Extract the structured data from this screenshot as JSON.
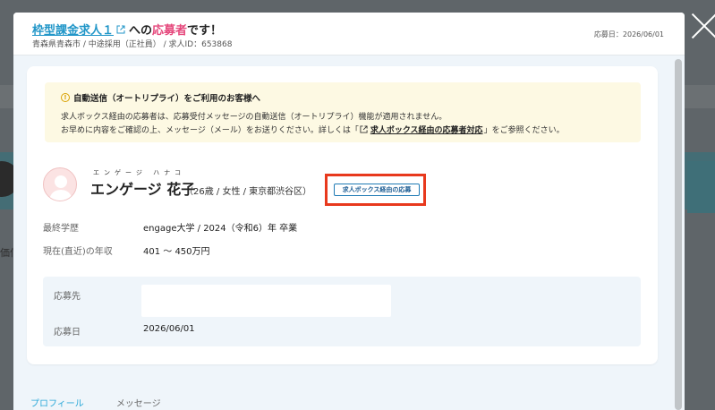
{
  "header": {
    "job_link": "枠型課金求人１",
    "to_text": "への",
    "applicant_word": "応募者",
    "end_text": "です！",
    "subtitle": "青森県青森市 / 中途採用（正社員） / 求人ID：653868",
    "applied_date": "応募日：2026/06/01"
  },
  "notice": {
    "title": "自動送信（オートリプライ）をご利用のお客様へ",
    "line1": "求人ボックス経由の応募者は、応募受付メッセージの自動送信（オートリプライ）機能が適用されません。",
    "line2_prefix": "お早めに内容をご確認の上、メッセージ（メール）をお送りください。詳しくは「",
    "line2_link": "求人ボックス経由の応募者対応",
    "line2_suffix": "」をご参照ください。"
  },
  "candidate": {
    "furigana": "エンゲージ ハナコ",
    "name": "エンゲージ 花子",
    "meta": "（26歳 / 女性 / 東京都渋谷区）",
    "badge": "求人ボックス経由の応募",
    "education_label": "最終学歴",
    "education_value": "engage大学 / 2024（令和6）年 卒業",
    "salary_label": "現在(直近)の年収",
    "salary_value": "401 〜 450万円"
  },
  "application": {
    "destination_label": "応募先",
    "destination_value": "",
    "date_label": "応募日",
    "date_value": "2026/06/01"
  },
  "tabs": [
    {
      "label": "プロフィール",
      "active": true
    },
    {
      "label": "メッセージ",
      "active": false
    }
  ],
  "background": {
    "partial_text": "価信ぇ"
  },
  "colors": {
    "link": "#2196c8",
    "applicant": "#e5487c",
    "highlight": "#e8391d",
    "notice_bg": "#fdf9e3",
    "tab_active": "#2aa8d8"
  },
  "icons": [
    "external-link-icon",
    "info-icon",
    "close-icon",
    "avatar-placeholder-icon"
  ]
}
